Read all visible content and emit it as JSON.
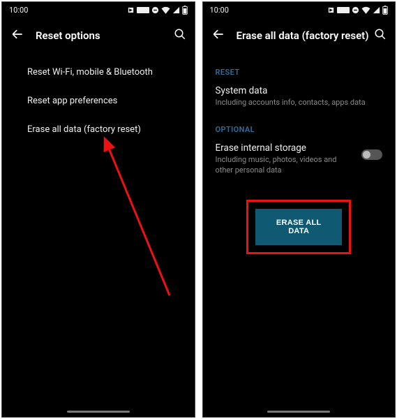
{
  "status": {
    "time": "10:00"
  },
  "left": {
    "title": "Reset options",
    "items": [
      "Reset Wi-Fi, mobile & Bluetooth",
      "Reset app preferences",
      "Erase all data (factory reset)"
    ]
  },
  "right": {
    "title": "Erase all data (factory reset)",
    "reset_section": "RESET",
    "system_data_title": "System data",
    "system_data_sub": "Including accounts info, contacts, apps data",
    "optional_section": "OPTIONAL",
    "storage_title": "Erase internal storage",
    "storage_sub": "Including music, photos, videos and other personal data",
    "erase_button": "ERASE ALL DATA"
  }
}
